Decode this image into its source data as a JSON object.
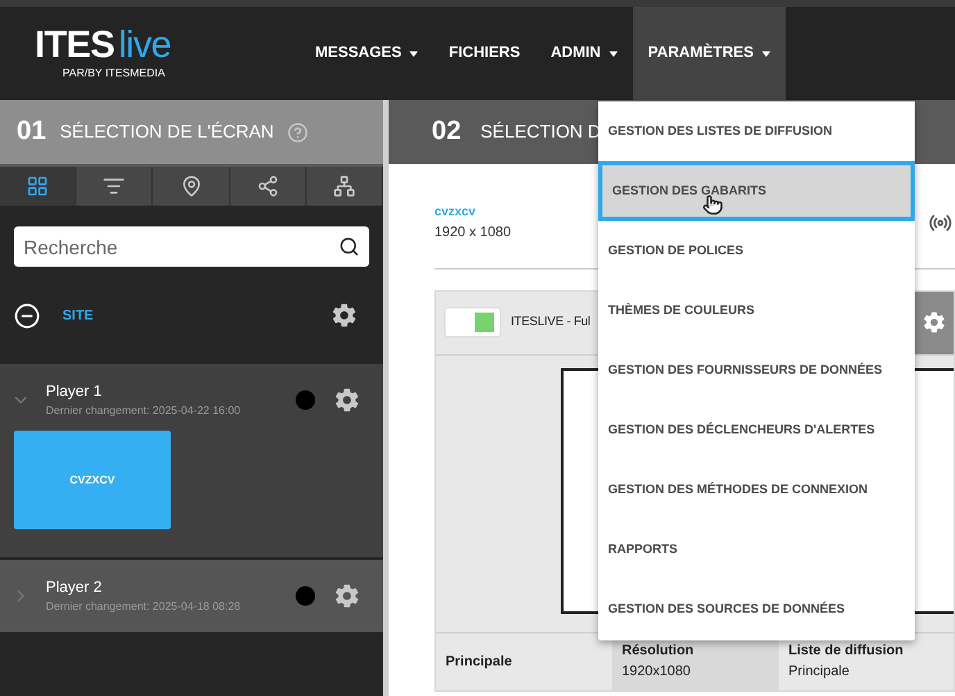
{
  "logo": {
    "brand": "ITES",
    "accent": "live",
    "tagline": "PAR/BY ITESMEDIA"
  },
  "nav": [
    {
      "label": "MESSAGES",
      "dropdown": true,
      "selected": false
    },
    {
      "label": "FICHIERS",
      "dropdown": false,
      "selected": false
    },
    {
      "label": "ADMIN",
      "dropdown": true,
      "selected": false
    },
    {
      "label": "PARAMÈTRES",
      "dropdown": true,
      "selected": true
    }
  ],
  "settings_menu": [
    {
      "label": "GESTION DES LISTES DE DIFFUSION",
      "selected": false
    },
    {
      "label": "GESTION DES GABARITS",
      "selected": true
    },
    {
      "label": "GESTION DE POLICES",
      "selected": false
    },
    {
      "label": "THÈMES DE COULEURS",
      "selected": false
    },
    {
      "label": "GESTION DES FOURNISSEURS DE DONNÉES",
      "selected": false
    },
    {
      "label": "GESTION DES DÉCLENCHEURS D'ALERTES",
      "selected": false
    },
    {
      "label": "GESTION DES MÉTHODES DE CONNEXION",
      "selected": false
    },
    {
      "label": "RAPPORTS",
      "selected": false
    },
    {
      "label": "GESTION DES SOURCES DE DONNÉES",
      "selected": false
    }
  ],
  "left": {
    "step": "01",
    "title": "SÉLECTION DE L'ÉCRAN",
    "view_tabs": [
      {
        "kind": "grid",
        "selected": true
      },
      {
        "kind": "filter",
        "selected": false
      },
      {
        "kind": "map",
        "selected": false
      },
      {
        "kind": "share",
        "selected": false
      },
      {
        "kind": "tree",
        "selected": false
      }
    ],
    "search": {
      "placeholder": "Recherche"
    },
    "site": {
      "label": "SITE",
      "expanded": true
    },
    "players": [
      {
        "name": "Player 1",
        "changed": "Dernier changement: 2025-04-22 16:00",
        "expanded": true,
        "color": "#000000",
        "screens": [
          "CVZXCV"
        ]
      },
      {
        "name": "Player 2",
        "changed": "Dernier changement: 2025-04-18 08:28",
        "expanded": false,
        "color": "#000000"
      }
    ]
  },
  "right": {
    "step": "02",
    "title": "SÉLECTION D",
    "screen": {
      "name": "cvzxcv",
      "resolution": "1920 x 1080"
    },
    "layout": {
      "on": true,
      "name": "ITESLIVE - Ful"
    },
    "info": {
      "name": "Principale",
      "fields": [
        {
          "label": "Résolution",
          "value": "1920x1080"
        },
        {
          "label": "Liste de diffusion",
          "value": "Principale"
        }
      ]
    }
  }
}
